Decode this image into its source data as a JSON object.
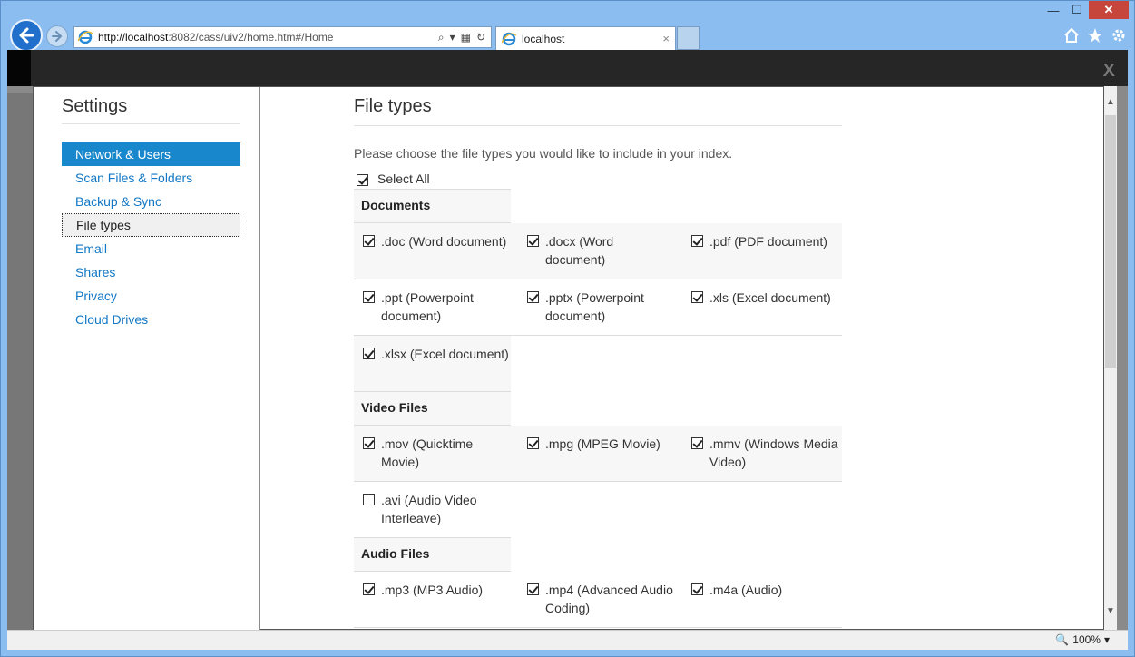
{
  "browser": {
    "url_host": "http://localhost",
    "url_rest": ":8082/cass/uiv2/home.htm#/Home",
    "tab_title": "localhost",
    "tab_close": "×",
    "zoom": "100%"
  },
  "window": {
    "minimize": "—",
    "maximize": "☐",
    "close": "✕"
  },
  "modal": {
    "close_label": "X"
  },
  "sidebar": {
    "title": "Settings",
    "items": [
      {
        "label": "Network & Users"
      },
      {
        "label": "Scan Files & Folders"
      },
      {
        "label": "Backup & Sync"
      },
      {
        "label": "File types"
      },
      {
        "label": "Email"
      },
      {
        "label": "Shares"
      },
      {
        "label": "Privacy"
      },
      {
        "label": "Cloud Drives"
      }
    ]
  },
  "main": {
    "title": "File types",
    "intro": "Please choose the file types you would like to include in your index.",
    "select_all": "Select All",
    "sections": [
      {
        "title": "Documents",
        "items": [
          {
            "label": ".doc (Word document)",
            "checked": true
          },
          {
            "label": ".docx (Word document)",
            "checked": true
          },
          {
            "label": ".pdf (PDF document)",
            "checked": true
          },
          {
            "label": ".ppt (Powerpoint document)",
            "checked": true
          },
          {
            "label": ".pptx (Powerpoint document)",
            "checked": true
          },
          {
            "label": ".xls (Excel document)",
            "checked": true
          },
          {
            "label": ".xlsx (Excel document)",
            "checked": true
          }
        ]
      },
      {
        "title": "Video Files",
        "items": [
          {
            "label": ".mov (Quicktime Movie)",
            "checked": true
          },
          {
            "label": ".mpg (MPEG Movie)",
            "checked": true
          },
          {
            "label": ".mmv (Windows Media Video)",
            "checked": true
          },
          {
            "label": ".avi (Audio Video Interleave)",
            "checked": false
          }
        ]
      },
      {
        "title": "Audio Files",
        "items": [
          {
            "label": ".mp3 (MP3 Audio)",
            "checked": true
          },
          {
            "label": ".mp4 (Advanced Audio Coding)",
            "checked": true
          },
          {
            "label": ".m4a (Audio)",
            "checked": true
          }
        ]
      }
    ]
  }
}
